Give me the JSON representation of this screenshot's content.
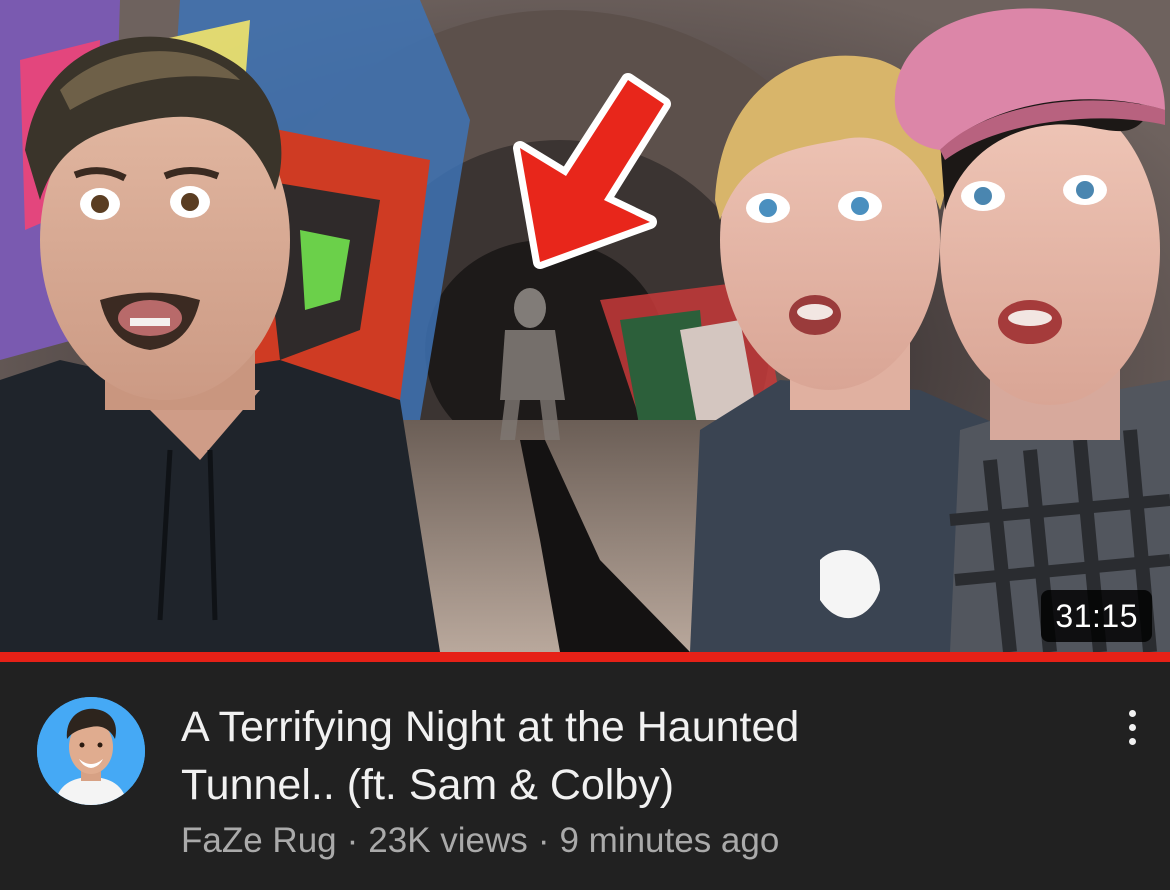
{
  "video": {
    "duration": "31:15",
    "watch_progress": 1.0,
    "title_line1": "A Terrifying Night at the Haunted",
    "title_line2": "Tunnel.. (ft. Sam & Colby)",
    "channel": "FaZe Rug",
    "views": "23K views",
    "published": "9 minutes ago",
    "separator": "·"
  },
  "colors": {
    "background": "#212121",
    "progress": "#e62117",
    "title_text": "#f1f1f1",
    "meta_text": "#aaaaaa",
    "avatar_bg": "#45a9f5",
    "arrow": "#e8261b"
  },
  "icons": {
    "more": "more-vert-icon",
    "thumbnail_arrow": "red-arrow-icon"
  }
}
